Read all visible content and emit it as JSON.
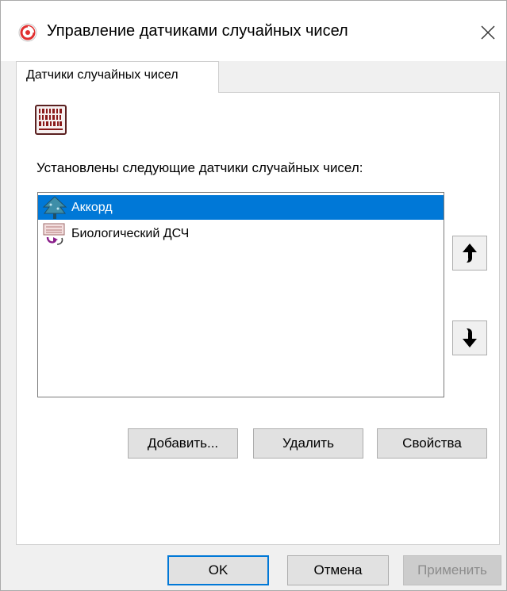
{
  "window": {
    "title": "Управление датчиками случайных чисел",
    "close_glyph": "✕"
  },
  "tabs": [
    {
      "label": "Датчики случайных чисел",
      "active": true
    }
  ],
  "panel": {
    "icon": "rng-chip-icon",
    "installed_label": "Установлены следующие датчики случайных чисел:",
    "sensors": [
      {
        "label": "Аккорд",
        "icon": "accord-tree-icon",
        "selected": true
      },
      {
        "label": "Биологический ДСЧ",
        "icon": "biological-rng-icon",
        "selected": false
      }
    ],
    "move_up_icon": "arrow-up-icon",
    "move_down_icon": "arrow-down-icon",
    "actions": {
      "add": "Добавить...",
      "remove": "Удалить",
      "properties": "Свойства"
    }
  },
  "footer": {
    "ok": "OK",
    "cancel": "Отмена",
    "apply": "Применить",
    "apply_disabled": true
  },
  "colors": {
    "selection": "#0078d7",
    "window_bg": "#f0f0f0",
    "default_button_border": "#0078d7"
  }
}
